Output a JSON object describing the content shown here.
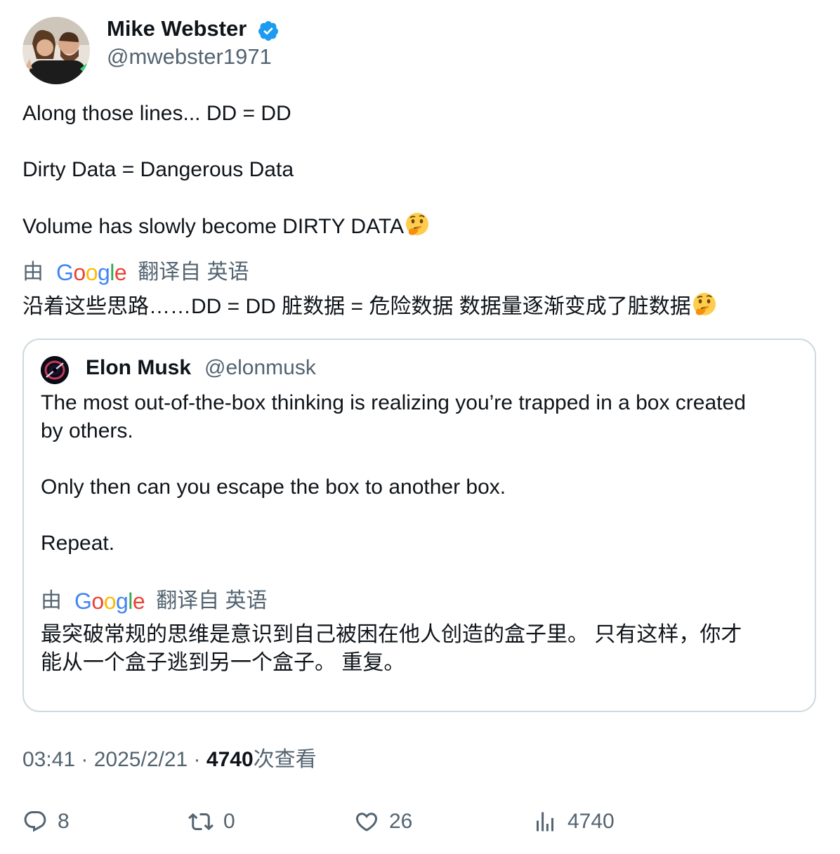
{
  "author": {
    "name": "Mike Webster",
    "handle": "@mwebster1971",
    "verified_color": "#1d9bf0"
  },
  "tweet": {
    "lines": [
      "Along those lines... DD = DD",
      "Dirty Data = Dangerous Data",
      "Volume has slowly become DIRTY DATA"
    ],
    "emoji": "thinking-face",
    "translation": {
      "by": "由",
      "google": "Google",
      "translated_from": "翻译自 英语",
      "text": "沿着这些思路……DD = DD 脏数据 = 危险数据 数据量逐渐变成了脏数据"
    }
  },
  "quoted_tweet": {
    "name": "Elon Musk",
    "handle": "@elonmusk",
    "lines": [
      "The most out-of-the-box thinking is realizing you’re trapped in a box created",
      "by others.",
      "Only then can you escape the box to another box.",
      "Repeat."
    ],
    "translation": {
      "by": "由",
      "google": "Google",
      "translated_from": "翻译自 英语",
      "lines": [
        "最突破常规的思维是意识到自己被困在他人创造的盒子里。 只有这样，你才",
        "能从一个盒子逃到另一个盒子。 重复。"
      ]
    }
  },
  "meta": {
    "time": "03:41",
    "sep1": " · ",
    "date": "2025/2/21",
    "sep2": " · ",
    "views": "4740",
    "views_suffix": "次查看"
  },
  "actions": {
    "replies": "8",
    "retweets": "0",
    "likes": "26",
    "views": "4740"
  }
}
